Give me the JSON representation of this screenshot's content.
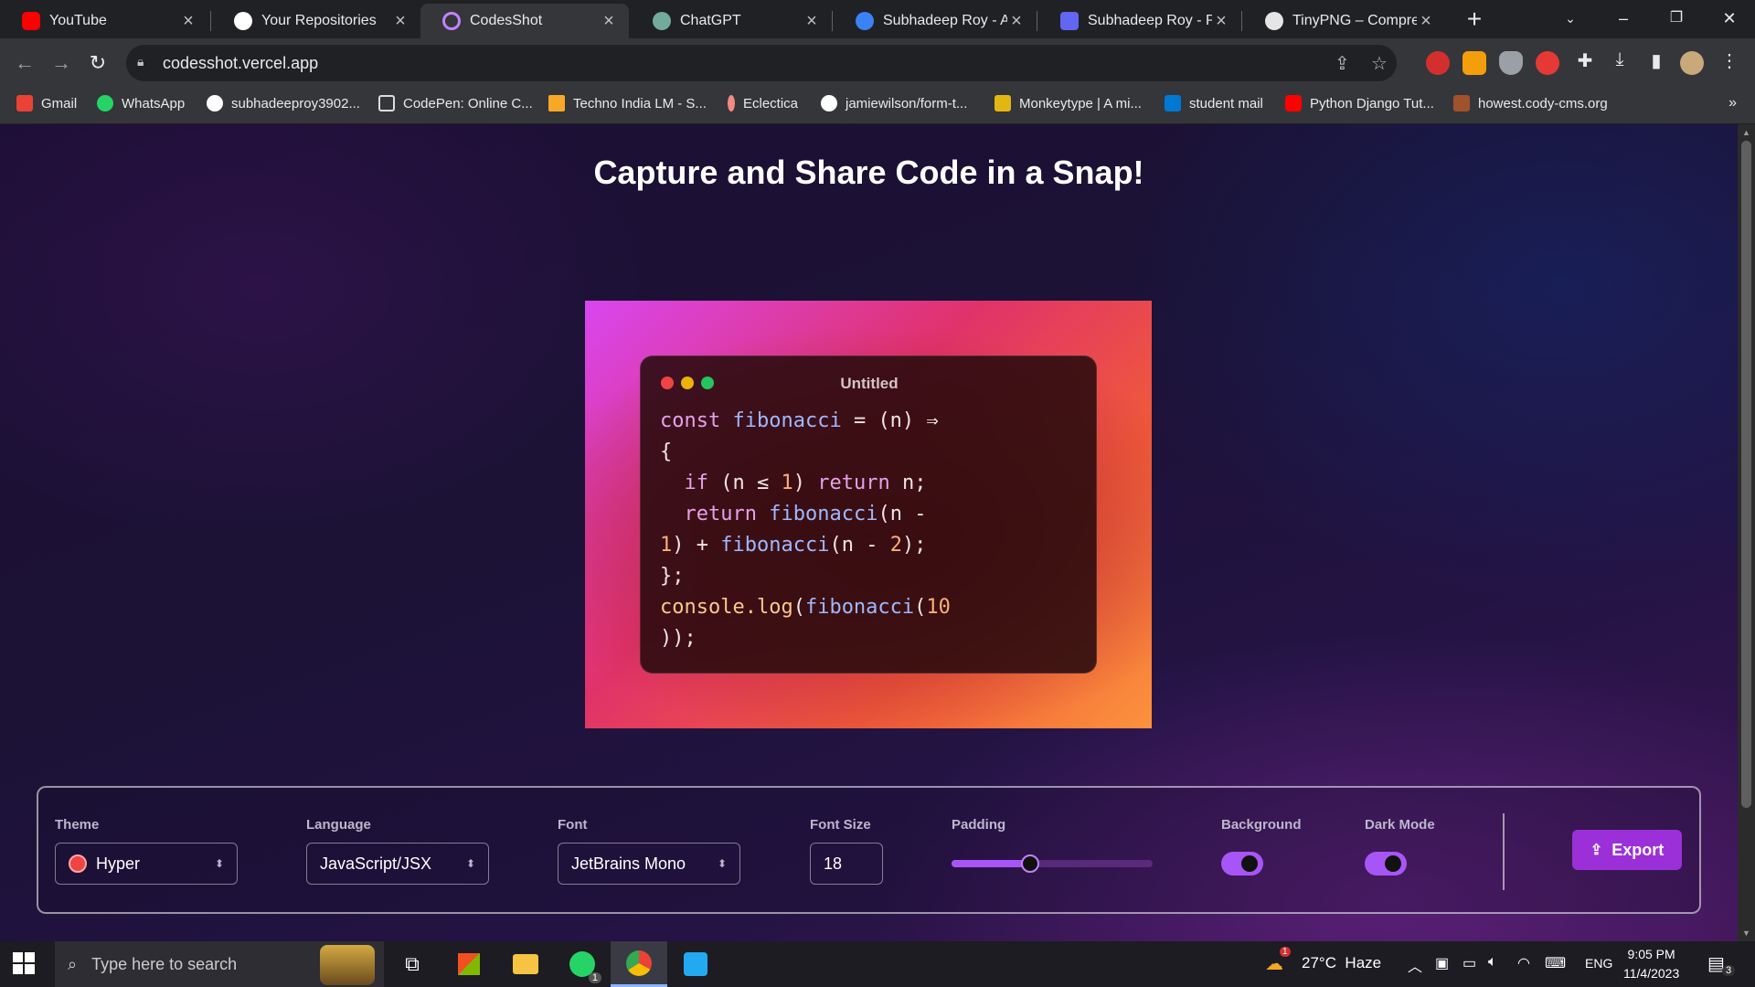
{
  "tabs": [
    {
      "title": "YouTube",
      "icon": "youtube-icon",
      "color": "#ff0000"
    },
    {
      "title": "Your Repositories",
      "icon": "github-icon",
      "color": "#ffffff"
    },
    {
      "title": "CodesShot",
      "icon": "codesshot-icon",
      "color": "#c084fc"
    },
    {
      "title": "ChatGPT",
      "icon": "chatgpt-icon",
      "color": "#74aa9c"
    },
    {
      "title": "Subhadeep Roy - A V",
      "icon": "portfolio-icon",
      "color": "#3b82f6"
    },
    {
      "title": "Subhadeep Roy - Po",
      "icon": "profile-icon",
      "color": "#6366f1"
    },
    {
      "title": "TinyPNG – Compress",
      "icon": "tinypng-icon",
      "color": "#e5e5e5"
    }
  ],
  "toolbar": {
    "url": "codesshot.vercel.app"
  },
  "bookmarks": [
    {
      "label": "Gmail",
      "color": "#ea4335"
    },
    {
      "label": "WhatsApp",
      "color": "#25d366"
    },
    {
      "label": "subhadeeproy3902...",
      "color": "#ffffff"
    },
    {
      "label": "CodePen: Online C...",
      "color": "#dddddd"
    },
    {
      "label": "Techno India LM - S...",
      "color": "#f9a825"
    },
    {
      "label": "Eclectica",
      "color": "#f28b82"
    },
    {
      "label": "jamiewilson/form-t...",
      "color": "#ffffff"
    },
    {
      "label": "Monkeytype | A mi...",
      "color": "#e2b714"
    },
    {
      "label": "student mail",
      "color": "#0078d4"
    },
    {
      "label": "Python Django Tut...",
      "color": "#ff0000"
    },
    {
      "label": "howest.cody-cms.org",
      "color": "#a0522d"
    }
  ],
  "page": {
    "title": "Capture and Share Code in a Snap!",
    "window_title": "Untitled",
    "code_lines": [
      [
        [
          "kw",
          "const "
        ],
        [
          "fn",
          "fibonacci"
        ],
        [
          "p",
          " = (n) ⇒"
        ]
      ],
      [
        [
          "p",
          "{"
        ]
      ],
      [
        [
          "p",
          "  "
        ],
        [
          "kw",
          "if"
        ],
        [
          "p",
          " (n ≤ "
        ],
        [
          "num",
          "1"
        ],
        [
          "p",
          ") "
        ],
        [
          "kw",
          "return"
        ],
        [
          "p",
          " n;"
        ]
      ],
      [
        [
          "p",
          "  "
        ],
        [
          "kw",
          "return"
        ],
        [
          "p",
          " "
        ],
        [
          "fn",
          "fibonacci"
        ],
        [
          "p",
          "(n -"
        ]
      ],
      [
        [
          "num",
          "1"
        ],
        [
          "p",
          ") + "
        ],
        [
          "fn",
          "fibonacci"
        ],
        [
          "p",
          "(n - "
        ],
        [
          "num",
          "2"
        ],
        [
          "p",
          ");"
        ]
      ],
      [
        [
          "p",
          "};"
        ]
      ],
      [
        [
          "mt",
          "console.log"
        ],
        [
          "p",
          "("
        ],
        [
          "fn",
          "fibonacci"
        ],
        [
          "p",
          "("
        ],
        [
          "num",
          "10"
        ]
      ],
      [
        [
          "p",
          "));"
        ]
      ]
    ]
  },
  "controls": {
    "theme_label": "Theme",
    "theme_value": "Hyper",
    "language_label": "Language",
    "language_value": "JavaScript/JSX",
    "font_label": "Font",
    "font_value": "JetBrains Mono",
    "fontsize_label": "Font Size",
    "fontsize_value": "18",
    "padding_label": "Padding",
    "padding_fraction": 0.39,
    "background_label": "Background",
    "background_on": true,
    "darkmode_label": "Dark Mode",
    "darkmode_on": true,
    "export_label": "Export"
  },
  "taskbar": {
    "search_placeholder": "Type here to search",
    "weather": "27°C  Haze",
    "weather_badge": "1",
    "whatsapp_badge": "1",
    "lang": "ENG",
    "time": "9:05 PM",
    "date": "11/4/2023",
    "notif_count": "3"
  }
}
